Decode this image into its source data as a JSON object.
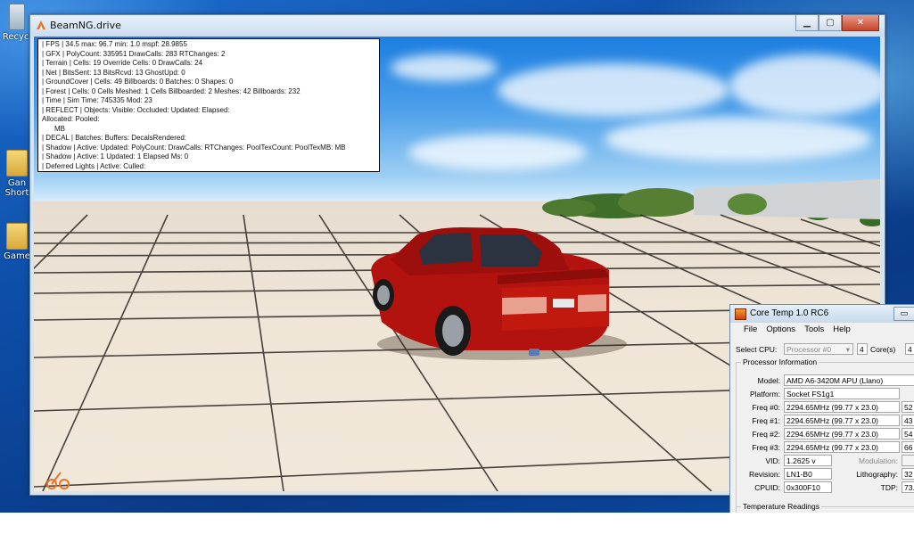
{
  "desktop": {
    "icons": [
      {
        "label": "Recycl"
      },
      {
        "label": "Gan Short"
      },
      {
        "label": "Game"
      }
    ]
  },
  "beamng": {
    "title": "BeamNG.drive",
    "controls": {
      "minimize": "▁",
      "maximize": "▢",
      "close": "✕"
    },
    "stats": [
      "| FPS |  34.5  max: 96.7  min:  1.0  mspf: 28.9855",
      "| GFX |  PolyCount: 335951  DrawCalls: 283  RTChanges: 2",
      "| Terrain |  Cells: 19  Override Cells: 0  DrawCalls: 24",
      "| Net |  BitsSent: 13  BitsRcvd: 13  GhostUpd: 0",
      "| GroundCover |  Cells: 49  Billboards: 0  Batches: 0  Shapes: 0",
      "| Forest |  Cells: 0  Cells Meshed: 1  Cells Billboarded: 2  Meshes: 42  Billboards: 232",
      "| Time |  Sim Time: 745335  Mod: 23",
      "| REFLECT |  Objects:    Visible:    Occluded:    Updated:    Elapsed:",
      "Allocated:    Pooled:",
      "MB",
      "| DECAL | Batches:  Buffers:  DecalsRendered:",
      "| Shadow |  Active:   Updated:   PolyCount:   DrawCalls:    RTChanges:    PoolTexCount:    PoolTexMB: MB",
      "| Shadow |  Active: 1  Updated: 1  Elapsed Ms: 0",
      "| Deferred Lights |  Active:    Culled:"
    ]
  },
  "coretemp": {
    "title": "Core Temp 1.0 RC6",
    "title_button": "▭",
    "menu": [
      "File",
      "Options",
      "Tools",
      "Help"
    ],
    "select_cpu_label": "Select CPU:",
    "processor_select": "Processor #0",
    "cores_count": "4",
    "cores_label": "Core(s)",
    "threads_count": "4",
    "proc_info_title": "Processor Information",
    "model_label": "Model:",
    "model_value": "AMD A6-3420M APU (Llano)",
    "platform_label": "Platform:",
    "platform_value": "Socket FS1g1",
    "freqs": [
      {
        "label": "Freq #0:",
        "value": "2294.65MHz (99.77 x 23.0)",
        "load": "52"
      },
      {
        "label": "Freq #1:",
        "value": "2294.65MHz (99.77 x 23.0)",
        "load": "43"
      },
      {
        "label": "Freq #2:",
        "value": "2294.65MHz (99.77 x 23.0)",
        "load": "54"
      },
      {
        "label": "Freq #3:",
        "value": "2294.65MHz (99.77 x 23.0)",
        "load": "66"
      }
    ],
    "vid_label": "VID:",
    "vid_value": "1.2625 v",
    "modulation_label": "Modulation:",
    "revision_label": "Revision:",
    "revision_value": "LN1-B0",
    "lithography_label": "Lithography:",
    "lithography_value": "32",
    "cpuid_label": "CPUID:",
    "cpuid_value": "0x300F10",
    "tdp_label": "TDP:",
    "tdp_value": "73.",
    "temp_title": "Temperature Readings"
  }
}
